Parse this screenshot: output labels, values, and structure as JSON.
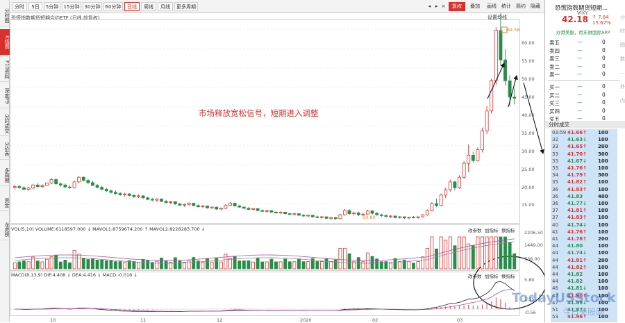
{
  "sidebar": [
    {
      "label": "分时图"
    },
    {
      "label": "K线图"
    },
    {
      "label": "F10资料"
    },
    {
      "label": "深度F9"
    },
    {
      "label": "分时成交"
    },
    {
      "label": "分价表"
    },
    {
      "label": "多周期"
    },
    {
      "label": "资金"
    },
    {
      "label": "龙虎榜"
    }
  ],
  "toolbar": {
    "periods": [
      "分时",
      "5日",
      "5分钟",
      "15分钟",
      "30分钟",
      "60分钟",
      "日线",
      "周线",
      "月线",
      "更多周期"
    ],
    "active_period": "日线",
    "right": [
      "复权",
      "叠加",
      "画线",
      "统计",
      "简约",
      "隐藏"
    ],
    "window_icons": [
      "◂",
      "▸",
      "×"
    ]
  },
  "chart": {
    "title": "恐慌指数期货短期合约ETF (日线,前复权)",
    "settings": "设置均线",
    "y_axis": [
      "60.00",
      "55.00",
      "50.00",
      "45.00",
      "40.00",
      "35.00",
      "30.00",
      "25.00",
      "20.00",
      "15.00"
    ],
    "max_label": "64.56",
    "min_label": "10.80",
    "annotation": "市场释放宽松信号，短期进入调整",
    "x_axis": [
      "10",
      "11",
      "12",
      "2020",
      "02",
      "03"
    ]
  },
  "volume": {
    "legend": "VOL(5,10)  VOLUME:6118597.000 ↓ MAVOL1:8759674.200 ↑ MAVOL2:8228283.700 ↓",
    "tools": [
      "改参数",
      "加指标",
      "换指标"
    ],
    "axis": [
      "2206.50",
      "1449.00",
      "736.00"
    ]
  },
  "macd": {
    "legend": "MACD(8,13,9) DIF:4.408 ↓ DEA:4.416 ↓ MACD:-0.016 ↓",
    "tools": [
      "改参数",
      "加指标",
      "换指标"
    ],
    "axis": [
      "5.80",
      "2.15",
      "-0.56"
    ]
  },
  "chart_data": {
    "type": "candlestick",
    "title": "恐慌指数期货短期合约ETF (日线,前复权)",
    "ylim": [
      10,
      62
    ],
    "candles": [
      [
        19.2,
        19.8,
        18.6,
        19.4
      ],
      [
        19.4,
        19.9,
        18.9,
        19.1
      ],
      [
        19.1,
        19.5,
        18.4,
        18.7
      ],
      [
        18.7,
        19.3,
        18.3,
        19.0
      ],
      [
        19.0,
        20.1,
        18.8,
        19.8
      ],
      [
        19.8,
        20.3,
        19.2,
        19.4
      ],
      [
        19.4,
        20.0,
        19.0,
        19.7
      ],
      [
        19.7,
        20.5,
        19.5,
        20.3
      ],
      [
        20.3,
        21.6,
        20.0,
        21.2
      ],
      [
        21.2,
        21.5,
        19.9,
        20.1
      ],
      [
        20.1,
        20.5,
        19.4,
        19.8
      ],
      [
        19.8,
        20.2,
        19.0,
        19.3
      ],
      [
        19.3,
        19.7,
        18.8,
        19.1
      ],
      [
        19.1,
        20.9,
        18.9,
        20.6
      ],
      [
        20.6,
        22.1,
        20.3,
        21.8
      ],
      [
        21.8,
        22.0,
        20.7,
        21.0
      ],
      [
        21.0,
        21.4,
        20.1,
        20.4
      ],
      [
        20.4,
        20.8,
        19.5,
        19.7
      ],
      [
        19.7,
        20.1,
        18.9,
        19.2
      ],
      [
        19.2,
        19.6,
        18.4,
        18.7
      ],
      [
        18.7,
        19.1,
        18.0,
        18.3
      ],
      [
        18.3,
        18.6,
        17.6,
        17.9
      ],
      [
        17.9,
        18.4,
        17.3,
        17.6
      ],
      [
        17.6,
        18.0,
        17.0,
        17.3
      ],
      [
        17.3,
        17.8,
        16.8,
        17.5
      ],
      [
        17.5,
        17.7,
        16.9,
        17.1
      ],
      [
        17.1,
        17.4,
        16.5,
        16.8
      ],
      [
        16.8,
        17.3,
        16.4,
        17.0
      ],
      [
        17.0,
        17.2,
        16.2,
        16.5
      ],
      [
        16.5,
        16.8,
        15.9,
        16.1
      ],
      [
        16.1,
        16.5,
        15.6,
        15.9
      ],
      [
        15.9,
        16.4,
        15.5,
        16.2
      ],
      [
        16.2,
        16.3,
        15.4,
        15.6
      ],
      [
        15.6,
        15.9,
        15.0,
        15.3
      ],
      [
        15.3,
        15.7,
        14.9,
        15.5
      ],
      [
        15.5,
        15.6,
        14.7,
        14.9
      ],
      [
        14.9,
        15.2,
        14.4,
        14.6
      ],
      [
        14.6,
        15.0,
        14.2,
        14.8
      ],
      [
        14.8,
        15.3,
        14.5,
        15.1
      ],
      [
        15.1,
        15.2,
        14.3,
        14.5
      ],
      [
        14.5,
        14.8,
        14.0,
        14.2
      ],
      [
        14.2,
        14.6,
        13.9,
        14.4
      ],
      [
        14.4,
        14.5,
        13.7,
        13.9
      ],
      [
        13.9,
        14.3,
        13.6,
        14.1
      ],
      [
        14.1,
        14.2,
        13.4,
        13.6
      ],
      [
        13.6,
        14.0,
        13.3,
        13.8
      ],
      [
        13.8,
        14.9,
        13.6,
        14.6
      ],
      [
        14.6,
        15.4,
        14.3,
        15.1
      ],
      [
        15.1,
        15.3,
        14.2,
        14.4
      ],
      [
        14.4,
        14.7,
        13.9,
        14.1
      ],
      [
        14.1,
        14.4,
        13.6,
        13.8
      ],
      [
        13.8,
        14.1,
        13.3,
        13.5
      ],
      [
        13.5,
        13.9,
        13.2,
        13.7
      ],
      [
        13.7,
        13.8,
        13.0,
        13.2
      ],
      [
        13.2,
        13.5,
        12.8,
        13.0
      ],
      [
        13.0,
        13.4,
        12.7,
        13.2
      ],
      [
        13.2,
        13.3,
        12.6,
        12.8
      ],
      [
        12.8,
        13.1,
        12.4,
        12.6
      ],
      [
        12.6,
        13.0,
        12.3,
        12.8
      ],
      [
        12.8,
        12.9,
        12.2,
        12.4
      ],
      [
        12.4,
        12.7,
        12.0,
        12.2
      ],
      [
        12.2,
        12.6,
        11.9,
        12.4
      ],
      [
        12.4,
        12.5,
        11.8,
        12.0
      ],
      [
        12.0,
        12.3,
        11.6,
        11.8
      ],
      [
        11.8,
        12.2,
        11.5,
        12.0
      ],
      [
        12.0,
        12.1,
        11.4,
        11.6
      ],
      [
        11.6,
        11.9,
        11.2,
        11.4
      ],
      [
        11.4,
        11.8,
        11.1,
        11.6
      ],
      [
        11.6,
        11.7,
        11.0,
        11.2
      ],
      [
        11.2,
        11.6,
        10.9,
        11.4
      ],
      [
        11.4,
        11.5,
        10.8,
        11.1
      ],
      [
        11.1,
        12.4,
        11.0,
        12.1
      ],
      [
        12.1,
        13.6,
        11.9,
        13.2
      ],
      [
        13.2,
        13.5,
        12.1,
        12.4
      ],
      [
        12.4,
        12.8,
        11.9,
        12.6
      ],
      [
        12.6,
        12.9,
        11.8,
        12.1
      ],
      [
        12.1,
        12.5,
        11.7,
        12.3
      ],
      [
        12.3,
        13.4,
        12.1,
        13.1
      ],
      [
        13.1,
        13.3,
        12.2,
        12.5
      ],
      [
        12.5,
        12.8,
        11.9,
        12.1
      ],
      [
        12.1,
        12.4,
        11.6,
        11.9
      ],
      [
        11.9,
        12.2,
        11.4,
        11.7
      ],
      [
        11.7,
        12.0,
        11.3,
        11.8
      ],
      [
        11.8,
        11.9,
        11.2,
        11.4
      ],
      [
        11.4,
        11.8,
        11.1,
        11.6
      ],
      [
        11.6,
        11.7,
        11.0,
        11.3
      ],
      [
        11.3,
        11.6,
        11.0,
        11.5
      ],
      [
        11.5,
        11.8,
        11.2,
        11.4
      ],
      [
        11.4,
        11.7,
        11.1,
        11.6
      ],
      [
        11.6,
        12.3,
        11.4,
        12.1
      ],
      [
        12.1,
        13.5,
        11.9,
        13.2
      ],
      [
        13.2,
        15.4,
        13.0,
        15.0
      ],
      [
        15.0,
        16.3,
        14.1,
        14.5
      ],
      [
        14.5,
        17.6,
        14.3,
        17.2
      ],
      [
        17.2,
        19.1,
        16.4,
        18.6
      ],
      [
        18.6,
        21.2,
        18.1,
        20.6
      ],
      [
        20.6,
        20.9,
        18.4,
        19.1
      ],
      [
        19.1,
        22.3,
        18.8,
        21.8
      ],
      [
        21.8,
        26.0,
        21.4,
        25.4
      ],
      [
        25.4,
        30.2,
        23.1,
        27.5
      ],
      [
        27.5,
        28.4,
        25.6,
        26.1
      ],
      [
        26.1,
        29.5,
        25.9,
        28.9
      ],
      [
        28.9,
        34.6,
        28.2,
        33.8
      ],
      [
        33.8,
        40.1,
        32.9,
        38.9
      ],
      [
        38.9,
        47.3,
        38.2,
        46.8
      ],
      [
        46.8,
        60.5,
        45.6,
        59.7
      ],
      [
        59.7,
        64.5,
        50.6,
        52.1
      ],
      [
        52.1,
        54.9,
        45.5,
        46.7
      ],
      [
        46.7,
        48.1,
        40.2,
        42.5
      ],
      [
        42.5,
        44.7,
        40.6,
        42.2
      ]
    ]
  },
  "right_panel": {
    "title": "恐慌指数期货短期...",
    "code": "VIXY",
    "price": "42.18",
    "change": "↑ 7.84",
    "pct": "15.67%",
    "ad": "炒港美股，用东财国际APP",
    "order_book": [
      {
        "label": "卖五",
        "dash": "—",
        "vol": "0"
      },
      {
        "label": "卖四",
        "dash": "—",
        "vol": "0"
      },
      {
        "label": "卖三",
        "dash": "—",
        "vol": "0"
      },
      {
        "label": "卖二",
        "dash": "—",
        "vol": "0"
      },
      {
        "label": "卖一",
        "dash": "—",
        "vol": "0"
      },
      {
        "label": "买一",
        "dash": "—",
        "vol": "0"
      },
      {
        "label": "买二",
        "dash": "—",
        "vol": "0"
      },
      {
        "label": "买三",
        "dash": "—",
        "vol": "0"
      },
      {
        "label": "买四",
        "dash": "—",
        "vol": "0"
      },
      {
        "label": "买五",
        "dash": "—",
        "vol": "0"
      }
    ],
    "ticks_header": "分时成交",
    "ticks": [
      {
        "t": "03:59",
        "p": "41.66↑",
        "v": "100",
        "d": "up"
      },
      {
        "t": "32",
        "p": "41.63↓",
        "v": "100",
        "d": "dn"
      },
      {
        "t": "33",
        "p": "41.65↑",
        "v": "200",
        "d": "up"
      },
      {
        "t": "33",
        "p": "41.70↑",
        "v": "300",
        "d": "up"
      },
      {
        "t": "33",
        "p": "41.67↓",
        "v": "100",
        "d": "dn"
      },
      {
        "t": "33",
        "p": "41.76↑",
        "v": "100",
        "d": "up"
      },
      {
        "t": "34",
        "p": "41.79↑",
        "v": "300",
        "d": "up"
      },
      {
        "t": "35",
        "p": "41.82↑",
        "v": "100",
        "d": "up"
      },
      {
        "t": "36",
        "p": "41.83↑",
        "v": "100",
        "d": "up"
      },
      {
        "t": "36",
        "p": "41.83",
        "v": "400",
        "d": "dn"
      },
      {
        "t": "36",
        "p": "41.77↓",
        "v": "100",
        "d": "dn"
      },
      {
        "t": "37",
        "p": "41.81↑",
        "v": "100",
        "d": "up"
      },
      {
        "t": "37",
        "p": "41.83↑",
        "v": "100",
        "d": "up"
      },
      {
        "t": "40",
        "p": "41.74↓",
        "v": "100",
        "d": "dn"
      },
      {
        "t": "41",
        "p": "41.76↑",
        "v": "100",
        "d": "up"
      },
      {
        "t": "41",
        "p": "41.78↑",
        "v": "200",
        "d": "up"
      },
      {
        "t": "44",
        "p": "41.80",
        "v": "100",
        "d": "dn"
      },
      {
        "t": "44",
        "p": "41.74↓",
        "v": "100",
        "d": "dn"
      },
      {
        "t": "44",
        "p": "41.81↑",
        "v": "200",
        "d": "up"
      },
      {
        "t": "44",
        "p": "41.82↑",
        "v": "100",
        "d": "up"
      },
      {
        "t": "44",
        "p": "41.82",
        "v": "100",
        "d": "dn"
      },
      {
        "t": "44",
        "p": "41.82",
        "v": "100",
        "d": "dn"
      },
      {
        "t": "46",
        "p": "41.81↓",
        "v": "100",
        "d": "dn"
      },
      {
        "t": "47",
        "p": "41.90↑",
        "v": "100",
        "d": "up"
      },
      {
        "t": "47",
        "p": "41.89↓",
        "v": "100",
        "d": "dn"
      },
      {
        "t": "51",
        "p": "41.87↓",
        "v": "100",
        "d": "dn"
      },
      {
        "t": "53",
        "p": "41.96↑",
        "v": "100",
        "d": "up"
      }
    ],
    "edge": [
      "分",
      "时",
      "图",
      "数",
      "...",
      "外",
      "内"
    ]
  },
  "watermark": "TodayUSStock",
  "watermark2": "今日美股网"
}
